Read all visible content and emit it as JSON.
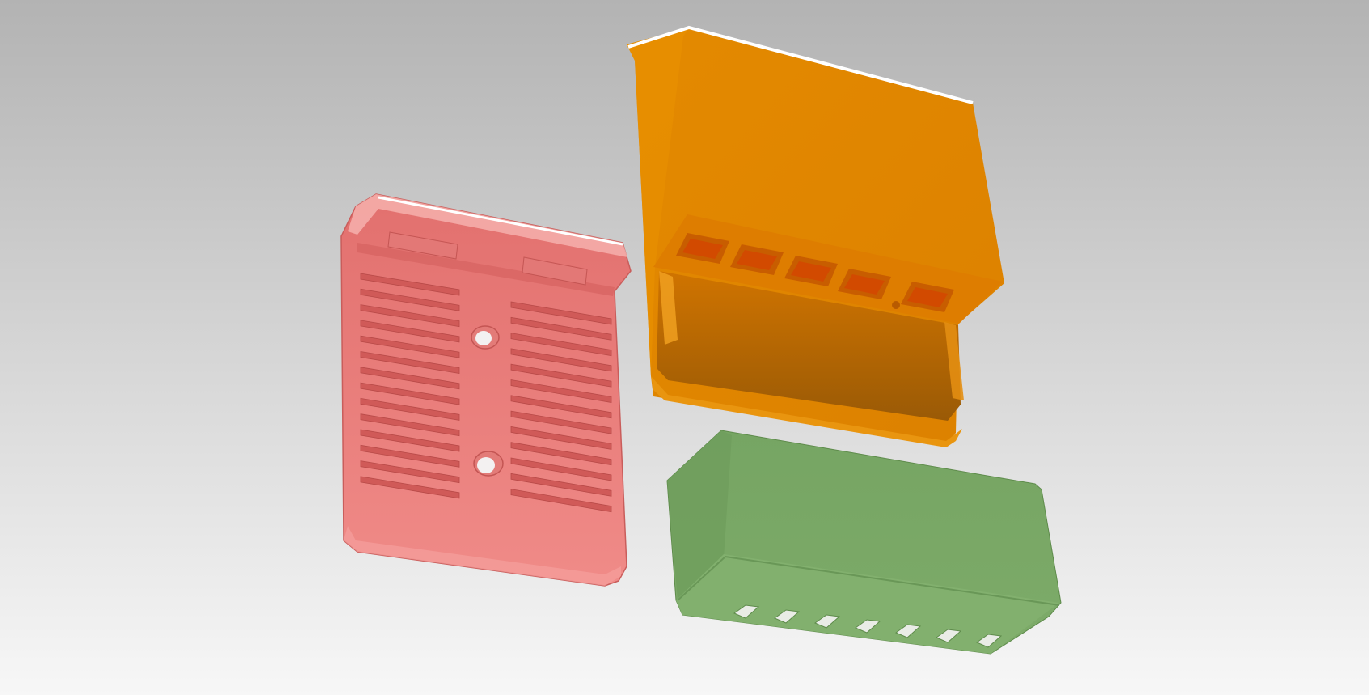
{
  "scene": {
    "background": {
      "top": "#b3b3b3",
      "bottom": "#f7f7f7"
    },
    "parts": [
      {
        "name": "pink-bottom-plate",
        "color": "#ee8481",
        "feature": "vent-slots-and-screw-holes"
      },
      {
        "name": "orange-main-case",
        "color": "#e08600",
        "feature": "port-openings"
      },
      {
        "name": "green-lid-cover",
        "color": "#79a865",
        "feature": "notched-edge"
      }
    ]
  }
}
